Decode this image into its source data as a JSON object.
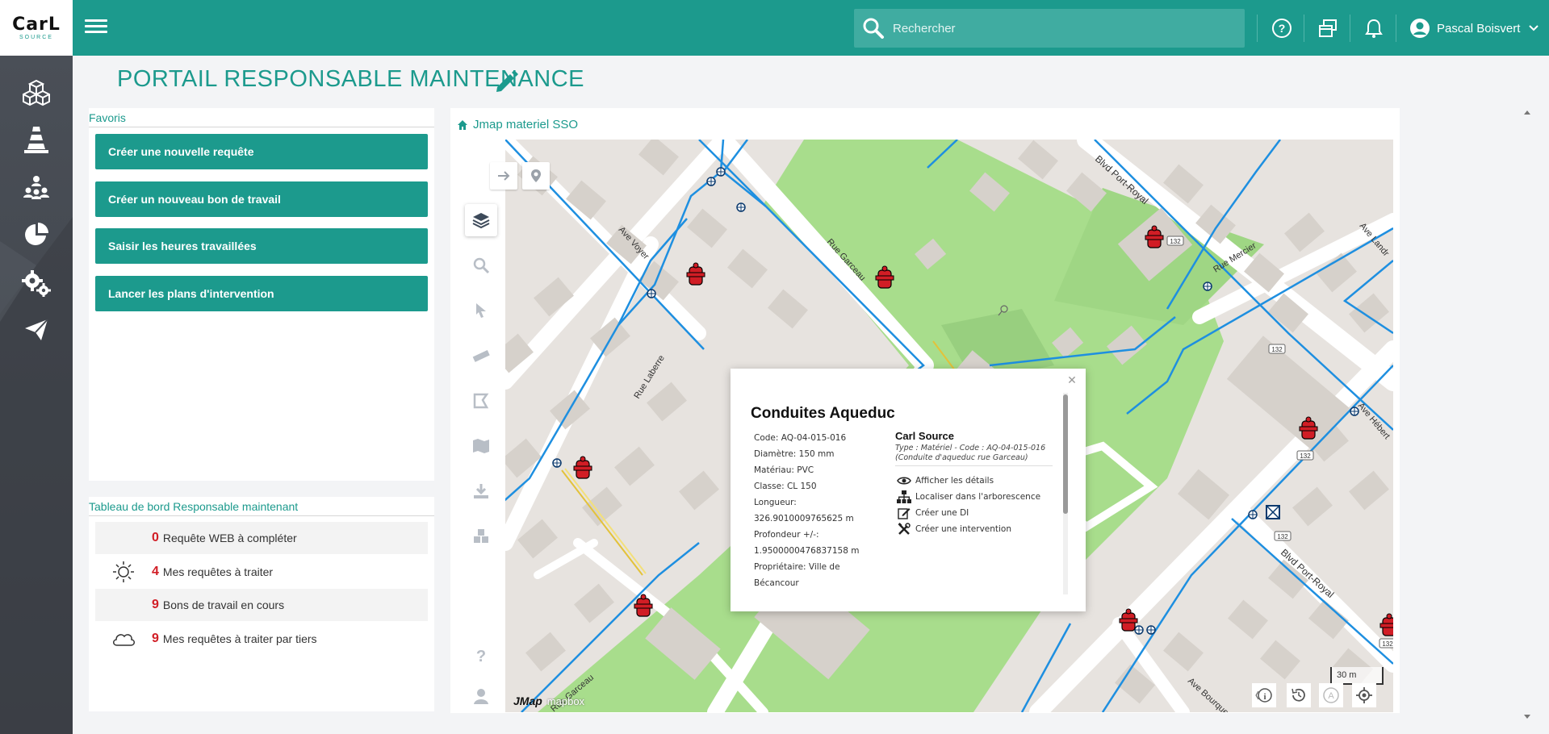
{
  "app": {
    "logo_main": "CarL",
    "logo_sub": "SOURCE",
    "user_name": "Pascal Boisvert"
  },
  "search": {
    "placeholder": "Rechercher"
  },
  "page": {
    "title": "PORTAIL RESPONSABLE MAINTENANCE"
  },
  "favoris": {
    "title": "Favoris",
    "items": [
      {
        "label": "Créer une nouvelle requête"
      },
      {
        "label": "Créer un nouveau bon de travail"
      },
      {
        "label": "Saisir les heures travaillées"
      },
      {
        "label": "Lancer les plans d'intervention"
      }
    ]
  },
  "dashboard": {
    "title": "Tableau de bord Responsable maintenant",
    "rows": [
      {
        "count": "0",
        "label": "Requête WEB à compléter",
        "icon": "none"
      },
      {
        "count": "4",
        "label": "Mes requêtes à traiter",
        "icon": "sun-icon"
      },
      {
        "count": "9",
        "label": "Bons de travail en cours",
        "icon": "none"
      },
      {
        "count": "9",
        "label": "Mes requêtes à traiter par tiers",
        "icon": "cloud-icon"
      }
    ]
  },
  "map": {
    "title": "Jmap materiel SSO",
    "labels": {
      "ave_voyer": "Ave Voyer",
      "rue_garceau": "Rue Garceau",
      "rue_laberre": "Rue Laberre",
      "blvd_port_royal_top": "Blvd Port-Royal",
      "blvd_port_royal_bottom": "Blvd Port-Royal",
      "rue_mercier": "Rue Mercier",
      "ave_hebert": "Ave Hébert",
      "ave_landry": "Ave Landr",
      "ave_bourque": "Ave Bourque",
      "rue_garceau_bottom": "Rue Garceau",
      "route_132": "132",
      "attribution_jmap": "JMap",
      "attribution_mapbox": "mapbox"
    },
    "scale": "30 m",
    "colors": {
      "pipe": "#1e8fe0",
      "hydrant": "#d11d25",
      "park": "#a8dd8c",
      "road": "#ffffff",
      "base": "#e7e3df"
    }
  },
  "popup": {
    "title": "Conduites Aqueduc",
    "details": [
      "Code: AQ-04-015-016",
      "Diamètre: 150 mm",
      "Matériau: PVC",
      "Classe: CL 150",
      "Longueur:",
      "326.9010009765625 m",
      "Profondeur +/-:",
      "1.9500000476837158 m",
      "Propriétaire: Ville de",
      "Bécancour"
    ],
    "source_title": "Carl Source",
    "source_sub": "Type : Matériel - Code : AQ-04-015-016 (Conduite d'aqueduc rue Garceau)",
    "actions": [
      {
        "label": "Afficher les détails",
        "icon": "eye-icon"
      },
      {
        "label": "Localiser dans l'arborescence",
        "icon": "hierarchy-icon"
      },
      {
        "label": "Créer une DI",
        "icon": "edit-icon"
      },
      {
        "label": "Créer une intervention",
        "icon": "tools-icon"
      }
    ]
  },
  "accent": "#1c9a8d",
  "count_color": "#d11d25"
}
